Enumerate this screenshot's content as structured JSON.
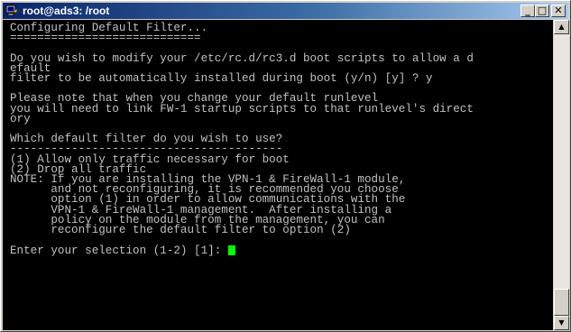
{
  "window": {
    "title": "root@ads3: /root",
    "app_icon": "putty-terminal-icon",
    "minimize_glyph": "_",
    "maximize_glyph": "□",
    "close_glyph": "✕"
  },
  "terminal": {
    "colors": {
      "background": "#000000",
      "text": "#c0c0c0",
      "cursor": "#00ff00"
    },
    "lines": [
      "Configuring Default Filter...",
      "============================",
      "",
      "Do you wish to modify your /etc/rc.d/rc3.d boot scripts to allow a d",
      "efault",
      "filter to be automatically installed during boot (y/n) [y] ? y",
      "",
      "Please note that when you change your default runlevel",
      "you will need to link FW-1 startup scripts to that runlevel's direct",
      "ory",
      "",
      "Which default filter do you wish to use?",
      "----------------------------------------",
      "(1) Allow only traffic necessary for boot",
      "(2) Drop all traffic",
      "NOTE: If you are installing the VPN-1 & FireWall-1 module,",
      "      and not reconfiguring, it is recommended you choose",
      "      option (1) in order to allow communications with the",
      "      VPN-1 & FireWall-1 management.  After installing a",
      "      policy on the module from the management, you can",
      "      reconfigure the default filter to option (2)",
      "",
      "Enter your selection (1-2) [1]: "
    ]
  },
  "scrollbar": {
    "up_glyph": "▲",
    "down_glyph": "▼"
  }
}
